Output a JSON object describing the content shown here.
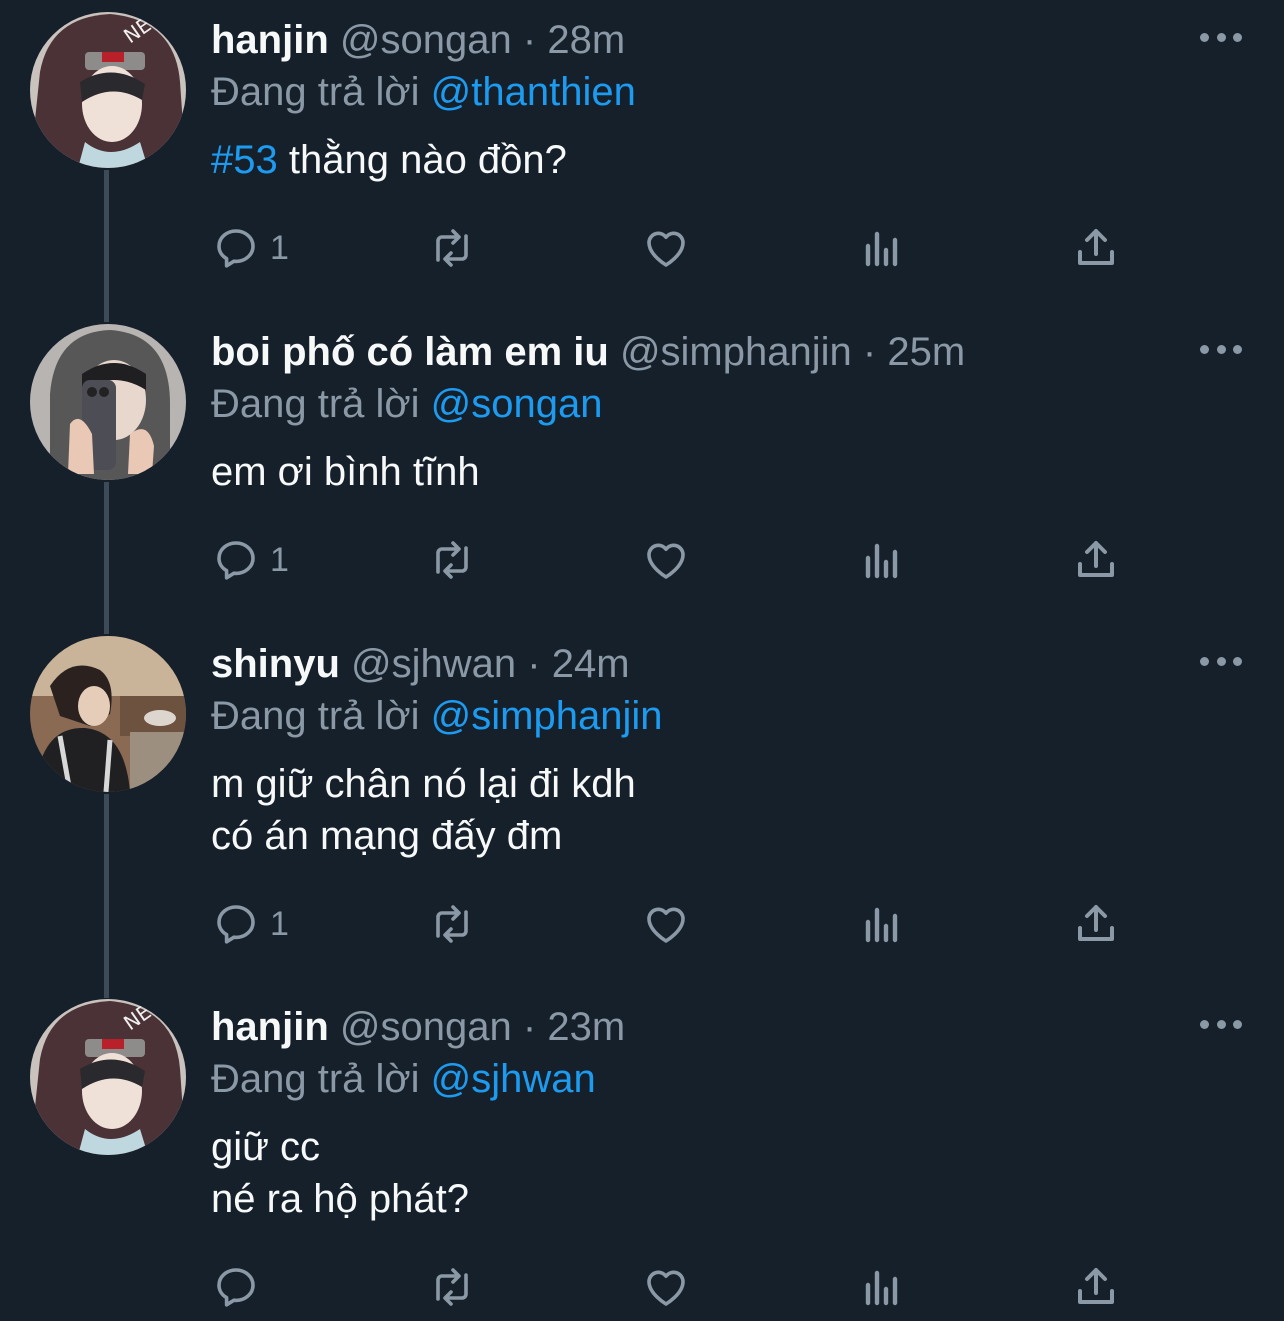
{
  "tweets": [
    {
      "name": "hanjin",
      "handle": "@songan",
      "sep": "·",
      "time": "28m",
      "reply_prefix": "Đang trả lời",
      "reply_to": "@thanthien",
      "body_hashtag": "#53",
      "body_lines": [
        " thằng nào đồn?"
      ],
      "reply_count": "1",
      "avatar": "hanjin-avatar"
    },
    {
      "name": "boi phố có làm em iu",
      "handle": "@simphanjin",
      "sep": "·",
      "time": "25m",
      "reply_prefix": "Đang trả lời",
      "reply_to": "@songan",
      "body_hashtag": "",
      "body_lines": [
        "em ơi bình tĩnh"
      ],
      "reply_count": "1",
      "avatar": "mirror-selfie-avatar"
    },
    {
      "name": "shinyu",
      "handle": "@sjhwan",
      "sep": "·",
      "time": "24m",
      "reply_prefix": "Đang trả lời",
      "reply_to": "@simphanjin",
      "body_hashtag": "",
      "body_lines": [
        "m giữ chân nó lại đi kdh",
        "có án mạng đấy đm"
      ],
      "reply_count": "1",
      "avatar": "restaurant-avatar"
    },
    {
      "name": "hanjin",
      "handle": "@songan",
      "sep": "·",
      "time": "23m",
      "reply_prefix": "Đang trả lời",
      "reply_to": "@sjhwan",
      "body_hashtag": "",
      "body_lines": [
        "giữ cc",
        "né ra hộ phát?"
      ],
      "reply_count": "",
      "avatar": "hanjin-avatar"
    }
  ],
  "icons": {
    "reply": "reply-icon",
    "retweet": "retweet-icon",
    "like": "heart-icon",
    "views": "analytics-icon",
    "share": "share-icon",
    "more": "more-options-icon"
  },
  "colors": {
    "background": "#15202b",
    "text": "#f7f9f9",
    "muted": "#8b98a5",
    "accent": "#1d9bf0",
    "thread_line": "#3d4a57"
  }
}
